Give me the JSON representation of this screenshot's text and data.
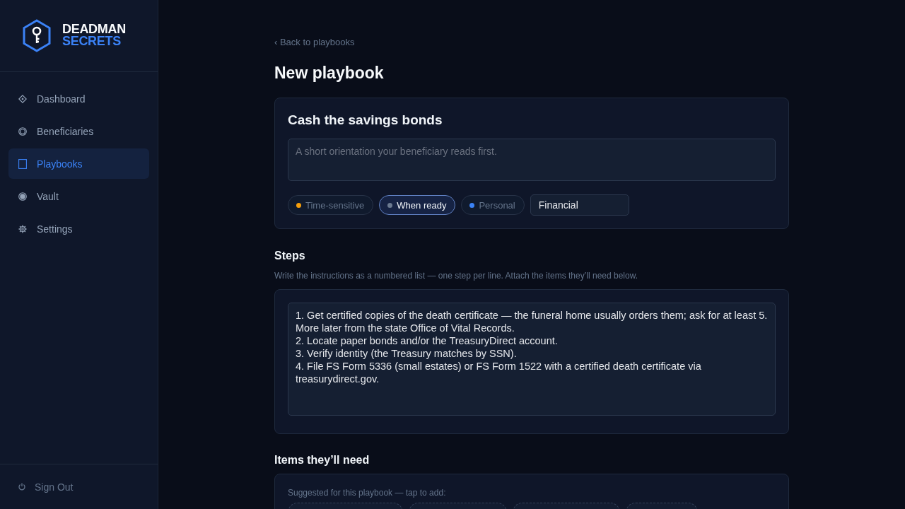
{
  "sidebar": {
    "brand": {
      "words": [
        "DEADMAN",
        "SECRETS"
      ]
    },
    "nav": [
      {
        "label": "Dashboard",
        "selected": false
      },
      {
        "label": "Beneficiaries",
        "selected": false
      },
      {
        "label": "Playbooks",
        "selected": true
      },
      {
        "label": "Vault",
        "selected": false
      },
      {
        "label": "Settings",
        "selected": false
      }
    ],
    "sign_out": {
      "label": "Sign Out"
    }
  },
  "back_link": "‹ Back to playbooks",
  "page_title": "New playbook",
  "playbook": {
    "title": "Cash the savings bonds",
    "summary": {
      "placeholder": "A short orientation your beneficiary reads first."
    },
    "urgency": [
      {
        "label": "Time-sensitive",
        "color": "#f59e0b",
        "selected": false
      },
      {
        "label": "When ready",
        "color": "#6b7a90",
        "selected": true
      },
      {
        "label": "Personal",
        "color": "#3b82f6",
        "selected": false
      }
    ],
    "category": {
      "value": "Financial"
    }
  },
  "steps": {
    "heading": "Steps",
    "hint": "Write the instructions as a numbered list — one step per line. Attach the items they’ll need below.",
    "value": "1. Get certified copies of the death certificate — the funeral home usually orders them; ask for at least 5. More later from the state Office of Vital Records.\n2. Locate paper bonds and/or the TreasuryDirect account.\n3. Verify identity (the Treasury matches by SSN).\n4. File FS Form 5336 (small estates) or FS Form 1522 with a certified death certificate via treasurydirect.gov."
  },
  "items": {
    "heading": "Items they’ll need",
    "hint": "Suggested for this playbook — tap to add:"
  }
}
